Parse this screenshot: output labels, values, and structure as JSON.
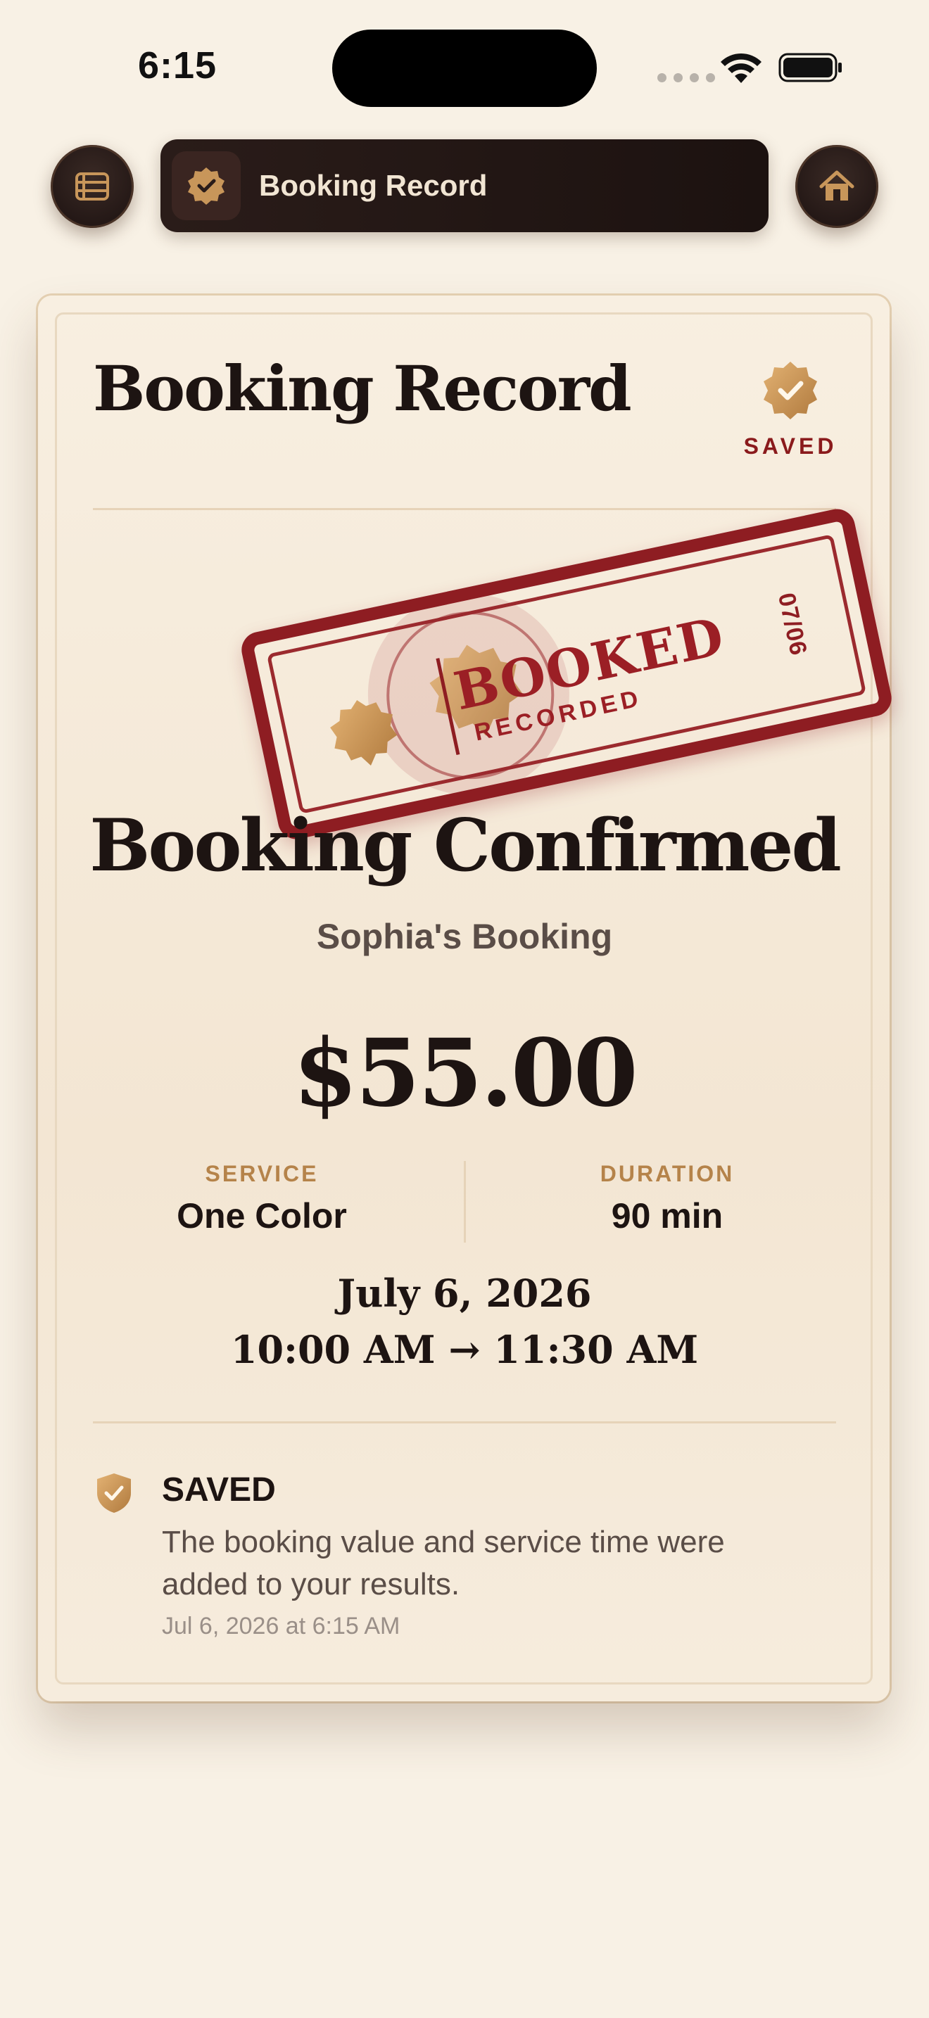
{
  "status_bar": {
    "time": "6:15"
  },
  "top_bar": {
    "title": "Booking Record",
    "menu_icon": "list-icon",
    "home_icon": "home-icon"
  },
  "card": {
    "header_title": "Booking Record",
    "saved_label": "SAVED",
    "stamp": {
      "main": "BOOKED",
      "sub": "RECORDED",
      "date": "07/06"
    },
    "headline": "Booking Confirmed",
    "subtitle": "Sophia's Booking",
    "amount": "$55.00",
    "service": {
      "label": "SERVICE",
      "value": "One Color"
    },
    "duration": {
      "label": "DURATION",
      "value": "90 min"
    },
    "date": "July 6, 2026",
    "time_range": "10:00 AM → 11:30 AM",
    "note": {
      "title": "SAVED",
      "body": "The booking value and service time were added to your results.",
      "timestamp": "Jul 6, 2026 at 6:15 AM"
    }
  },
  "colors": {
    "background": "#f8f1e5",
    "stamp_red": "#8e1d22",
    "gold": "#b5834a",
    "dark": "#1d1412"
  }
}
